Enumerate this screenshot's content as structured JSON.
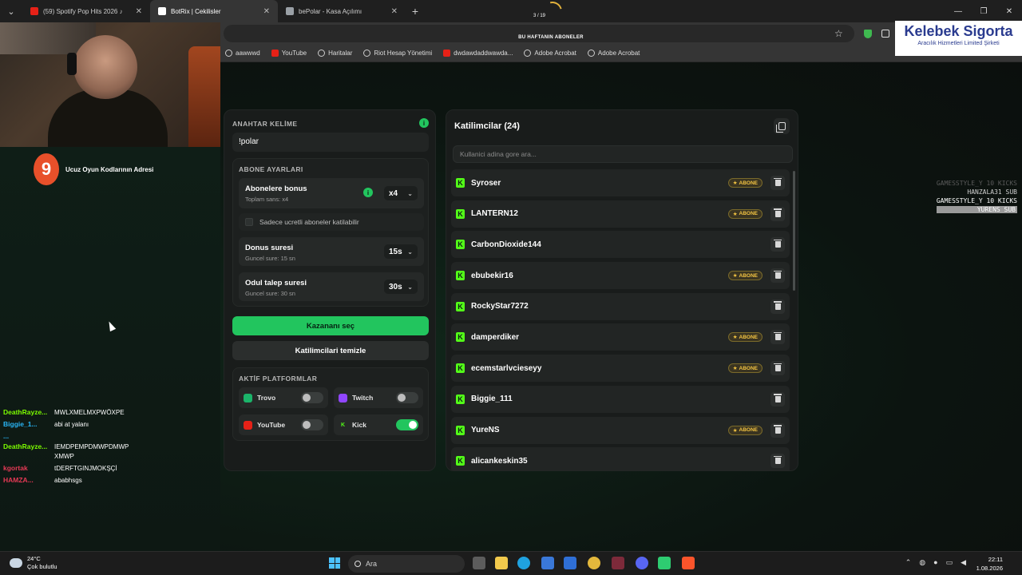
{
  "browser": {
    "tabs": [
      {
        "title": "(59) Spotify Pop Hits 2026 ♪",
        "active": false,
        "favicon_color": "#e62117"
      },
      {
        "title": "BotRix | Cekilisler",
        "active": true,
        "favicon_color": "#ffffff"
      },
      {
        "title": "bePolar - Kasa Açılımı",
        "active": false,
        "favicon_color": "#9aa0a6"
      }
    ],
    "new_tab": "+",
    "window_controls": [
      "—",
      "❐",
      "✕"
    ],
    "bookmarks": [
      {
        "label": "aawwwd",
        "icon": "globe-icon"
      },
      {
        "label": "YouTube",
        "icon": "youtube-icon"
      },
      {
        "label": "Haritalar",
        "icon": "maps-icon"
      },
      {
        "label": "Riot Hesap Yönetimi",
        "icon": "riot-icon"
      },
      {
        "label": "dwdawdaddwawda...",
        "icon": "youtube-icon"
      },
      {
        "label": "Adobe Acrobat",
        "icon": "globe-icon"
      },
      {
        "label": "Adobe Acrobat",
        "icon": "globe-icon"
      }
    ]
  },
  "overlay": {
    "counter": "3 / 19",
    "weekly_title": "BU HAFTANIN ABONELER",
    "promo_text": "Ucuz Oyun Kodlarının Adresi",
    "promo_logo": "9",
    "sponsor_title": "Kelebek Sigorta",
    "sponsor_sub": "Aracılık Hizmetleri Limited Şirketi",
    "events": [
      {
        "text": "GAMESSTYLE_Y 10 KICKS",
        "color": "#5a5a5a"
      },
      {
        "text": "HANZALA31 SUB",
        "color": "#cfcfcf"
      },
      {
        "text": "GAMESSTYLE_Y 10 KICKS",
        "color": "#ffffff"
      },
      {
        "text": "YURENS SUB",
        "color": "#ffffff",
        "highlight": true
      }
    ]
  },
  "chat": [
    {
      "user": "DeathRayze...",
      "color": "#7cfc00",
      "msg": "MWLXMELMXPWÖXPE"
    },
    {
      "user": "Biggie_1...",
      "color": "#29b6f6",
      "msg": "abi at yalanı"
    },
    {
      "user": "...",
      "color": "#29b6f6",
      "msg": ""
    },
    {
      "user": "DeathRayze...",
      "color": "#7cfc00",
      "msg": "IEMDPEMPDMWPDMWPXMWP"
    },
    {
      "user": "kgortak",
      "color": "#e53955",
      "msg": "tDERFTGINJMOKŞÇİ"
    },
    {
      "user": "HAMZA...",
      "color": "#e53955",
      "msg": "ababhsgs"
    }
  ],
  "left_panel": {
    "keyword_label": "ANAHTAR KELİME",
    "keyword_value": "!polar",
    "sub_settings_label": "ABONE AYARLARI",
    "sub_bonus_title": "Abonelere bonus",
    "sub_bonus_sub": "Toplam sans: x4",
    "sub_bonus_value": "x4",
    "paid_only_label": "Sadece ucretli aboneler katilabilir",
    "bonus_time_title": "Donus suresi",
    "bonus_time_sub": "Guncel sure: 15 sn",
    "bonus_time_value": "15s",
    "claim_time_title": "Odul talep suresi",
    "claim_time_sub": "Guncel sure: 30 sn",
    "claim_time_value": "30s",
    "pick_winner": "Kazananı seç",
    "clear_participants": "Katilimcilari temizle",
    "platforms_label": "AKTİF PLATFORMLAR",
    "platforms": [
      {
        "name": "Trovo",
        "color": "#1bb46a",
        "on": false
      },
      {
        "name": "Twitch",
        "color": "#9146ff",
        "on": false
      },
      {
        "name": "YouTube",
        "color": "#e62117",
        "on": false
      },
      {
        "name": "Kick",
        "color": "#53fc18",
        "on": true
      }
    ]
  },
  "right_panel": {
    "title": "Katilimcilar (24)",
    "search_placeholder": "Kullanici adina gore ara...",
    "badge_label": "ABONE",
    "participants": [
      {
        "name": "Syroser",
        "sub": true
      },
      {
        "name": "LANTERN12",
        "sub": true
      },
      {
        "name": "CarbonDioxide144",
        "sub": false
      },
      {
        "name": "ebubekir16",
        "sub": true
      },
      {
        "name": "RockyStar7272",
        "sub": false
      },
      {
        "name": "damperdiker",
        "sub": true
      },
      {
        "name": "ecemstarlvcieseyy",
        "sub": true
      },
      {
        "name": "Biggie_111",
        "sub": false
      },
      {
        "name": "YureNS",
        "sub": true
      },
      {
        "name": "alicankeskin35",
        "sub": false
      }
    ]
  },
  "taskbar": {
    "temp": "24°C",
    "weather": "Çok bulutlu",
    "search": "Ara",
    "time": "22:11",
    "date": "1.08.2026"
  }
}
